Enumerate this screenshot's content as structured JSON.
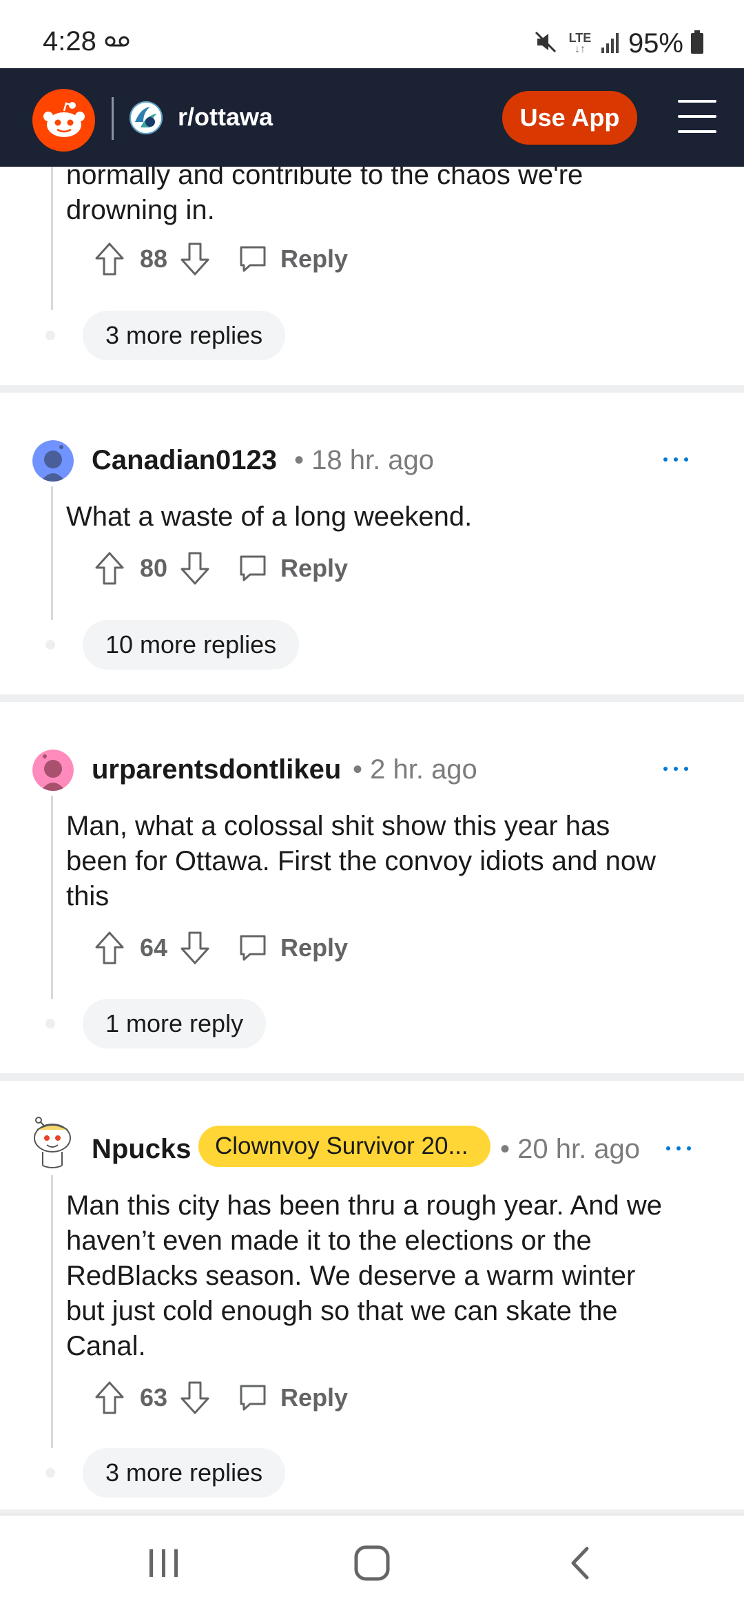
{
  "status_bar": {
    "time": "4:28",
    "network": "LTE",
    "battery": "95%"
  },
  "header": {
    "subreddit": "r/ottawa",
    "use_app_label": "Use App"
  },
  "comments": [
    {
      "body_partial": "normally and contribute to the chaos we're drowning in.",
      "votes": "88",
      "reply_label": "Reply",
      "more": "3 more replies"
    },
    {
      "username": "Canadian0123",
      "time": "• 18 hr. ago",
      "body": "What a waste of a long weekend.",
      "votes": "80",
      "reply_label": "Reply",
      "more": "10 more replies",
      "avatar_color": "#7193ff"
    },
    {
      "username": "urparentsdontlikeu",
      "time": "• 2 hr. ago",
      "body": "Man, what a colossal shit show this year has been for Ottawa. First the convoy idiots and now this",
      "votes": "64",
      "reply_label": "Reply",
      "more": "1 more reply",
      "avatar_color": "#ff66ac"
    },
    {
      "username": "Npucks",
      "flair": "Clownvoy Survivor 20...",
      "time": "• 20 hr. ago",
      "body": "Man this city has been thru a rough year. And we haven’t even made it to the elections or the RedBlacks season. We deserve a warm winter but just cold enough so that we can skate the Canal.",
      "votes": "63",
      "reply_label": "Reply",
      "more": "3 more replies"
    }
  ],
  "colors": {
    "header_bg": "#1a2233",
    "brand": "#ff4500",
    "use_app_bg": "#d93900",
    "flair_bg": "#ffd635",
    "action_gray": "#636466"
  }
}
